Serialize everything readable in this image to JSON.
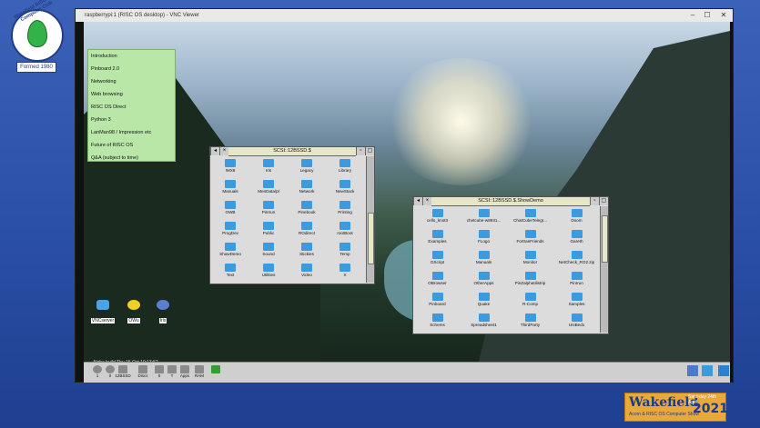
{
  "club_logo": {
    "circle_text": "Wakefield RISC-OS Computer Club",
    "formed": "Formed 1980"
  },
  "vnc_window": {
    "title": "raspberrypi:1 (RISC OS desktop) - VNC Viewer",
    "minimize": "–",
    "maximize": "☐",
    "close": "✕"
  },
  "agenda": [
    "Introduction",
    "Pinboard 2.0",
    "Networking",
    "Web browsing",
    "RISC OS Direct",
    "Python 3",
    "LanMan98 / Impression etc",
    "Future of RISC OS",
    "Q&A (subject to time)"
  ],
  "filer1": {
    "title": "SCSI::12BSSD.$",
    "items": [
      "!MX6",
      "Iris",
      "Legacy",
      "Library",
      "Manuals",
      "MenData/pl",
      "Network",
      "NewStack",
      "OWB",
      "PinIrun",
      "Pinebook",
      "Printing",
      "ProgDev",
      "Public",
      "ROdirect",
      "rootBoot",
      "ShowDemo",
      "Sound",
      "Stickies",
      "Temp",
      "Text",
      "Utilities",
      "Video",
      "X"
    ]
  },
  "filer2": {
    "title": "SCSI::12BSSD.$.ShowDemo",
    "items": [
      "cello_knot3",
      "chetcube-w8931...",
      "ChatCubeTelegr...",
      "Doom",
      "Examples",
      "FLogo",
      "FortranFriends",
      "Gareth",
      "GScript",
      "Manuals",
      "Monitor",
      "NetCheck_RO2.zip",
      "OBrowser",
      "OtherApps",
      "PinZalphatilistrip",
      "PinIrun",
      "Pinboard",
      "Quake",
      "R-Comp",
      "Samples",
      "Schems",
      "Spreadsheet1",
      "ThirdParty",
      "UniBed1"
    ]
  },
  "desktop_icons": [
    "VNCserver",
    "OWu",
    "Iris"
  ],
  "status_text": "Alpha build Thu,15 Oct 19:13:52",
  "iconbar": {
    "left": [
      {
        "label": "1",
        "icon": "disc-icon"
      },
      {
        "label": "0",
        "icon": "disc-icon"
      },
      {
        "label": "12BSSD",
        "icon": "harddisc-icon"
      },
      {
        "label": "Discs",
        "icon": "discs-icon"
      },
      {
        "label": "0",
        "icon": "floppy-icon"
      },
      {
        "label": "T",
        "icon": "floppy-icon"
      },
      {
        "label": "Apps",
        "icon": "apps-icon"
      },
      {
        "label": "RAM",
        "icon": "ram-icon"
      },
      {
        "label": "",
        "icon": "bin-icon"
      }
    ],
    "right": [
      "display-icon",
      "riscos-icon",
      "taskmanager-icon"
    ]
  },
  "event_brand": {
    "name": "Wakefield",
    "date": "Saturday 24th April",
    "year": "2021",
    "subtitle": "Acorn & RISC OS Computer Show"
  },
  "colors": {
    "page_bg": "#2a4fa6",
    "folder_blue": "#3b9be0",
    "agenda_bg": "#b9e7a7",
    "brand_orange": "#e8a93a"
  }
}
